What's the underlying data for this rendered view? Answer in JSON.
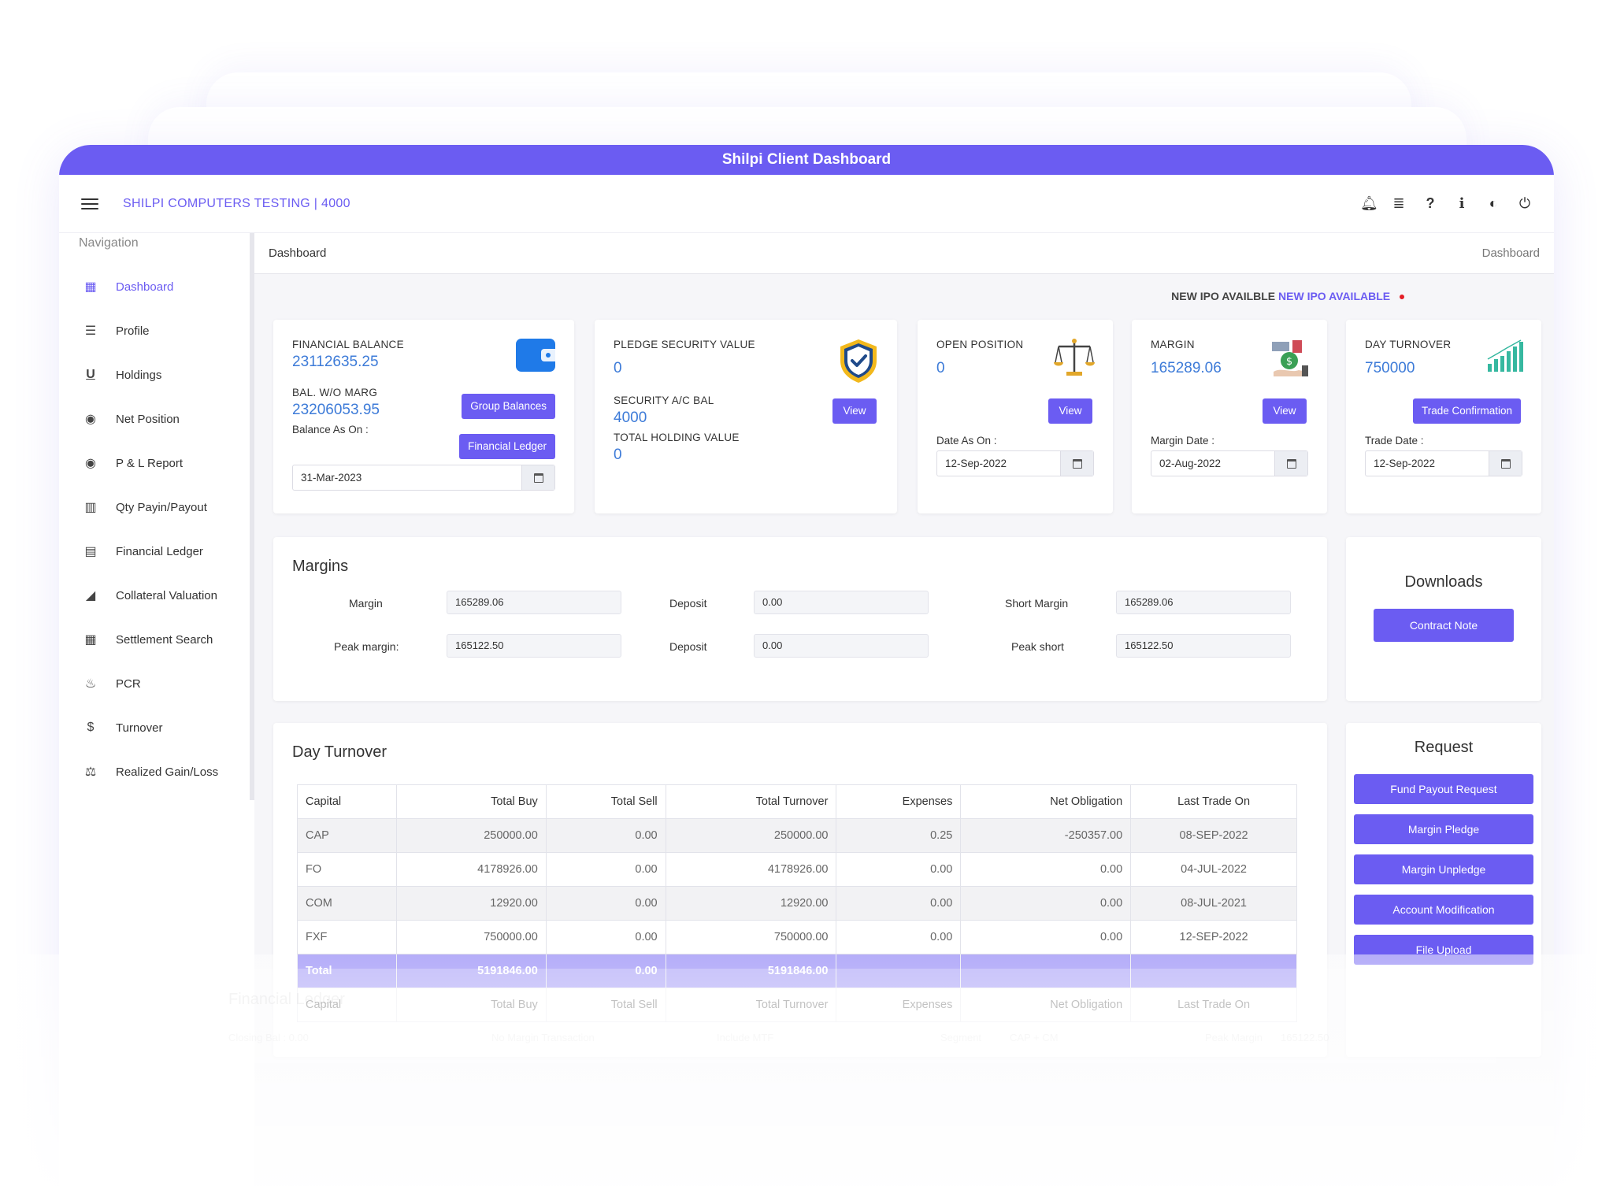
{
  "title_bar": "Shilpi Client Dashboard",
  "org_name": "SHILPI COMPUTERS TESTING | 4000",
  "nav_title": "Navigation",
  "nav_items": [
    {
      "label": "Dashboard",
      "icon": "dashboard-grid-icon"
    },
    {
      "label": "Profile",
      "icon": "list-icon"
    },
    {
      "label": "Holdings",
      "icon": "underline-u-icon"
    },
    {
      "label": "Net Position",
      "icon": "radio-circle-icon"
    },
    {
      "label": "P & L Report",
      "icon": "radio-circle-icon"
    },
    {
      "label": "Qty Payin/Payout",
      "icon": "bar-chart-icon"
    },
    {
      "label": "Financial Ledger",
      "icon": "book-icon"
    },
    {
      "label": "Collateral Valuation",
      "icon": "area-chart-icon"
    },
    {
      "label": "Settlement Search",
      "icon": "table-icon"
    },
    {
      "label": "PCR",
      "icon": "fire-icon"
    },
    {
      "label": "Turnover",
      "icon": "dollar-icon"
    },
    {
      "label": "Realized Gain/Loss",
      "icon": "balance-scale-icon"
    }
  ],
  "breadcrumb": {
    "left": "Dashboard",
    "right": "Dashboard"
  },
  "ipo": {
    "label": "NEW IPO AVAILBLE",
    "link": "NEW IPO AVAILABLE"
  },
  "financial_balance": {
    "label": "FINANCIAL BALANCE",
    "value": "23112635.25",
    "bal_label": "BAL. W/O MARG",
    "bal_value": "23206053.95",
    "as_on_label": "Balance As On :",
    "date": "31-Mar-2023",
    "group_btn": "Group Balances",
    "ledger_btn": "Financial Ledger"
  },
  "pledge": {
    "label": "PLEDGE SECURITY VALUE",
    "value": "0",
    "sec_label": "SECURITY A/C BAL",
    "sec_value": "4000",
    "hold_label": "TOTAL HOLDING VALUE",
    "hold_value": "0",
    "view_btn": "View"
  },
  "open_position": {
    "label": "OPEN POSITION",
    "value": "0",
    "view_btn": "View",
    "date_label": "Date As On :",
    "date": "12-Sep-2022"
  },
  "margin_card": {
    "label": "MARGIN",
    "value": "165289.06",
    "view_btn": "View",
    "date_label": "Margin Date :",
    "date": "02-Aug-2022"
  },
  "day_turnover_card": {
    "label": "DAY TURNOVER",
    "value": "750000",
    "btn": "Trade Confirmation",
    "date_label": "Trade Date :",
    "date": "12-Sep-2022"
  },
  "margins": {
    "title": "Margins",
    "margin_label": "Margin",
    "margin_value": "165289.06",
    "deposit_label": "Deposit",
    "deposit_value": "0.00",
    "short_label": "Short Margin",
    "short_value": "165289.06",
    "peak_label": "Peak margin:",
    "peak_value": "165122.50",
    "deposit2_label": "Deposit",
    "deposit2_value": "0.00",
    "peak_short_label": "Peak short",
    "peak_short_value": "165122.50"
  },
  "downloads": {
    "title": "Downloads",
    "btn": "Contract Note"
  },
  "day_turnover_table": {
    "title": "Day Turnover",
    "headers": [
      "Capital",
      "Total Buy",
      "Total Sell",
      "Total Turnover",
      "Expenses",
      "Net Obligation",
      "Last Trade On"
    ],
    "rows": [
      [
        "CAP",
        "250000.00",
        "0.00",
        "250000.00",
        "0.25",
        "-250357.00",
        "08-SEP-2022"
      ],
      [
        "FO",
        "4178926.00",
        "0.00",
        "4178926.00",
        "0.00",
        "0.00",
        "04-JUL-2022"
      ],
      [
        "COM",
        "12920.00",
        "0.00",
        "12920.00",
        "0.00",
        "0.00",
        "08-JUL-2021"
      ],
      [
        "FXF",
        "750000.00",
        "0.00",
        "750000.00",
        "0.00",
        "0.00",
        "12-SEP-2022"
      ]
    ],
    "total": [
      "Total",
      "5191846.00",
      "0.00",
      "5191846.00",
      "",
      "",
      ""
    ]
  },
  "request": {
    "title": "Request",
    "buttons": [
      "Fund Payout Request",
      "Margin Pledge",
      "Margin Unpledge",
      "Account Modification",
      "File Upload"
    ]
  },
  "faded_ledger": {
    "title": "Financial Ledger",
    "items": [
      "Closing Bal : 0.00",
      "No Margin Transaction",
      "Include MTF",
      "Segment",
      "CAP + CM",
      "Peak Margin",
      "165122.50"
    ]
  },
  "colors": {
    "accent": "#6b5cf2",
    "value_blue": "#3d7bd8",
    "ipo_dot": "#e41e26"
  }
}
